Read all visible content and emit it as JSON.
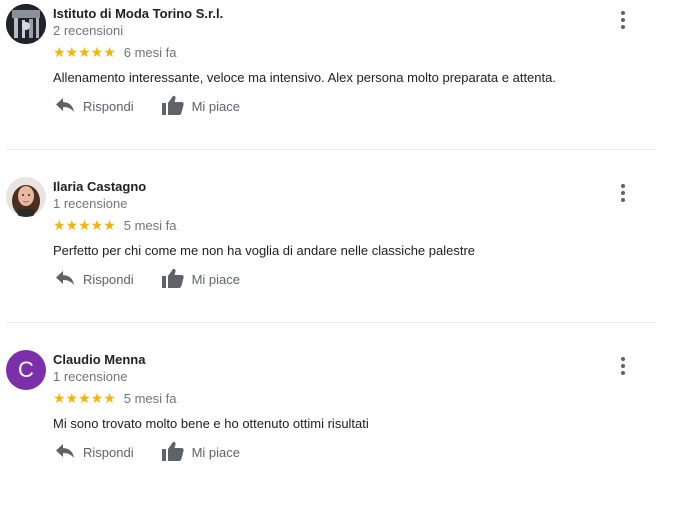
{
  "reviews": [
    {
      "name": "Istituto di Moda Torino S.r.l.",
      "count": "2 recensioni",
      "stars": "★★★★★",
      "time": "6 mesi fa",
      "text": "Allenamento interessante, veloce ma intensivo. Alex persona molto preparata e attenta.",
      "reply": "Rispondi",
      "like": "Mi piace",
      "avatar": "photo"
    },
    {
      "name": "Ilaria Castagno",
      "count": "1 recensione",
      "stars": "★★★★★",
      "time": "5 mesi fa",
      "text": "Perfetto per chi come me non ha voglia di andare nelle classiche palestre",
      "reply": "Rispondi",
      "like": "Mi piace",
      "avatar": "photo"
    },
    {
      "name": "Claudio Menna",
      "count": "1 recensione",
      "stars": "★★★★★",
      "time": "5 mesi fa",
      "text": "Mi sono trovato molto bene e ho ottenuto ottimi risultati",
      "reply": "Rispondi",
      "like": "Mi piace",
      "avatar_letter": "C"
    }
  ],
  "colors": {
    "star": "#f4b400",
    "avatar_bg": "#7b2fa8",
    "muted": "#70757a"
  },
  "icons": [
    "reply-icon",
    "thumbs-up-icon",
    "more-vert-icon"
  ]
}
